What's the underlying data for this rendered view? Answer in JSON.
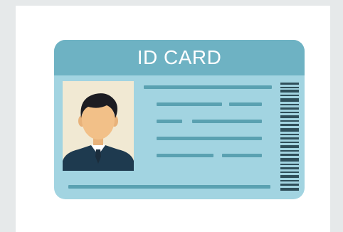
{
  "card": {
    "title": "ID CARD"
  },
  "colors": {
    "page_background": "#e6e9ea",
    "card_body": "#a2d4e1",
    "card_header": "#6eb2c3",
    "line_accent": "#5aa1b1",
    "photo_background": "#f1e9d3",
    "barcode": "#2f4f5a"
  },
  "icons": [
    "person-avatar-icon",
    "barcode-icon"
  ]
}
